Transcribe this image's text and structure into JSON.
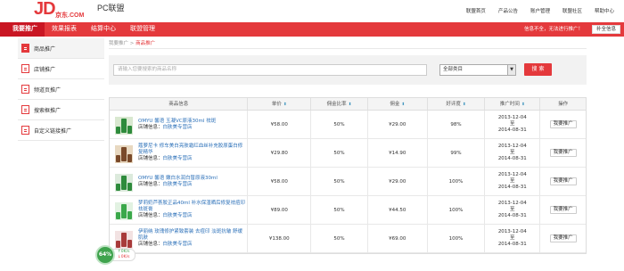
{
  "header": {
    "logo_text": "JD",
    "logo_sub": "京东.COM",
    "brand": "PC联盟",
    "links": [
      "联盟首页",
      "产品公告",
      "账户管理",
      "联盟社区",
      "帮助中心"
    ]
  },
  "nav": {
    "tabs": [
      "我要推广",
      "效果报表",
      "结算中心",
      "联盟管理"
    ],
    "active_tab": "我要推广",
    "notice": "信息不全，无法进行推广！",
    "fill_button": "补全信息"
  },
  "sidebar": {
    "items": [
      {
        "label": "商品推广",
        "active": true
      },
      {
        "label": "店铺推广",
        "active": false
      },
      {
        "label": "频道页推广",
        "active": false
      },
      {
        "label": "搜索框推广",
        "active": false
      },
      {
        "label": "自定义链接推广",
        "active": false
      }
    ]
  },
  "breadcrumb": {
    "parent": "我要推广",
    "sep": ">",
    "current": "商品推广"
  },
  "search": {
    "placeholder": "请输入您要搜索的商品名称",
    "category": "全部类目",
    "button": "搜 索"
  },
  "table": {
    "headers": [
      "商品信息",
      "单价",
      "佣金比率",
      "佣金",
      "好评度",
      "推广时间",
      "操作"
    ],
    "rows": [
      {
        "name": "OMYU 馨语 玉凝VC原液30ml 祛斑",
        "shop_label": "店铺信息：",
        "shop": "白肤美专营店",
        "price": "¥58.00",
        "rate": "50%",
        "commission": "¥29.00",
        "praise": "98%",
        "date_from": "2013-12-04",
        "date_to_label": "至",
        "date_to": "2014-08-31",
        "action": "我要推广"
      },
      {
        "name": "蔻萝尼卡 修车美白亮肤霜红血丝补充胶原蛋白修复精华",
        "shop_label": "店铺信息：",
        "shop": "白肤美专营店",
        "price": "¥29.80",
        "rate": "50%",
        "commission": "¥14.90",
        "praise": "99%",
        "date_from": "2013-12-04",
        "date_to_label": "至",
        "date_to": "2014-08-31",
        "action": "我要推广"
      },
      {
        "name": "OMYU 馨语 嫩白水润白皙原液30ml",
        "shop_label": "店铺信息：",
        "shop": "白肤美专营店",
        "price": "¥58.00",
        "rate": "50%",
        "commission": "¥29.00",
        "praise": "100%",
        "date_from": "2013-12-04",
        "date_to_label": "至",
        "date_to": "2014-08-31",
        "action": "我要推广"
      },
      {
        "name": "梦莉奶芦荟胶正品40ml 补水保湿晒后修复祛痘印祛斑膏",
        "shop_label": "店铺信息：",
        "shop": "白肤美专营店",
        "price": "¥89.00",
        "rate": "50%",
        "commission": "¥44.50",
        "praise": "100%",
        "date_from": "2013-12-04",
        "date_to_label": "至",
        "date_to": "2014-08-31",
        "action": "我要推广"
      },
      {
        "name": "伊丽纳 玫瑰修护紧致套装 去痘印 淡斑抗皱 舒缓肌肤",
        "shop_label": "店铺信息：",
        "shop": "白肤美专营店",
        "price": "¥138.00",
        "rate": "50%",
        "commission": "¥69.00",
        "praise": "100%",
        "date_from": "2013-12-04",
        "date_to_label": "至",
        "date_to": "2014-08-31",
        "action": "我要推广"
      }
    ]
  },
  "net_widget": {
    "percent": "64%",
    "up": "0K/s",
    "down": "0K/s"
  },
  "colors": {
    "brand_red": "#e4393c",
    "link_blue": "#2a6fb8"
  }
}
